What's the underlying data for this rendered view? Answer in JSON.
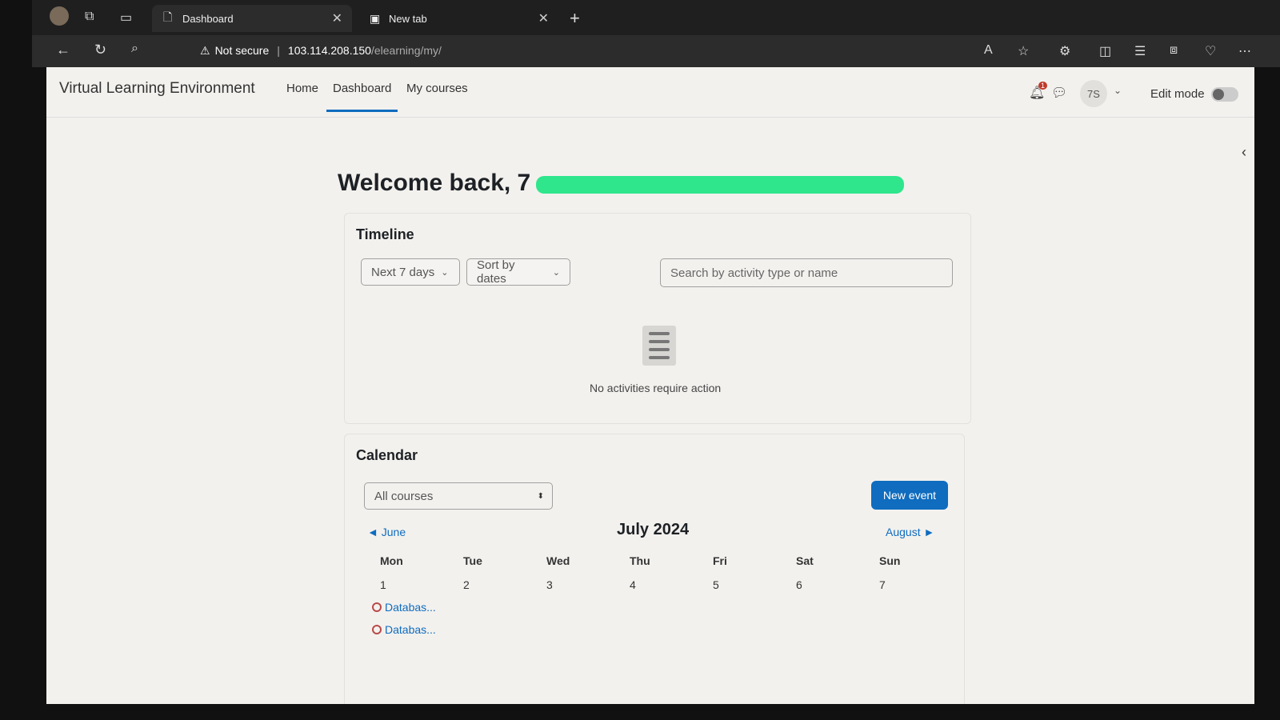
{
  "browser": {
    "tabs": [
      {
        "label": "Dashboard"
      },
      {
        "label": "New tab"
      }
    ],
    "address": {
      "warning": "Not secure",
      "host": "103.114.208.150",
      "path": "/elearning/my/"
    }
  },
  "navbar": {
    "brand": "Virtual Learning Environment",
    "links": [
      "Home",
      "Dashboard",
      "My courses"
    ],
    "notification_count": "1",
    "avatar_initials": "7S",
    "edit_mode_label": "Edit mode"
  },
  "welcome": "Welcome back, 7",
  "timeline": {
    "title": "Timeline",
    "range_label": "Next 7 days",
    "sort_label": "Sort by dates",
    "search_placeholder": "Search by activity type or name",
    "empty_text": "No activities require action"
  },
  "calendar": {
    "title": "Calendar",
    "course_select": "All courses",
    "new_event_label": "New event",
    "prev_month": "June",
    "current_month": "July 2024",
    "next_month": "August",
    "days_of_week": [
      "Mon",
      "Tue",
      "Wed",
      "Thu",
      "Fri",
      "Sat",
      "Sun"
    ],
    "day_numbers": [
      "1",
      "2",
      "3",
      "4",
      "5",
      "6",
      "7"
    ],
    "events": [
      "Databas...",
      "Databas..."
    ]
  }
}
